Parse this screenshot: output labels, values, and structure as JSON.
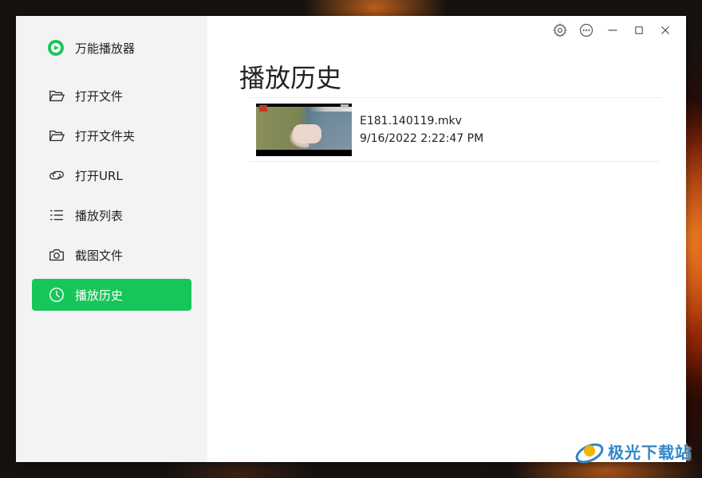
{
  "app": {
    "name": "万能播放器",
    "logo": "play-circle-logo",
    "accent_color": "#16c659"
  },
  "sidebar": {
    "items": [
      {
        "label": "打开文件",
        "icon": "folder-open-icon",
        "active": false
      },
      {
        "label": "打开文件夹",
        "icon": "folder-open-icon",
        "active": false
      },
      {
        "label": "打开URL",
        "icon": "link-icon",
        "active": false
      },
      {
        "label": "播放列表",
        "icon": "list-icon",
        "active": false
      },
      {
        "label": "截图文件",
        "icon": "camera-icon",
        "active": false
      },
      {
        "label": "播放历史",
        "icon": "clock-icon",
        "active": true
      }
    ]
  },
  "title_bar": {
    "buttons": [
      "settings-icon",
      "more-icon",
      "minimize-icon",
      "maximize-icon",
      "close-icon"
    ]
  },
  "main": {
    "title": "播放历史",
    "history": [
      {
        "file_name": "E181.140119.mkv",
        "time": "9/16/2022 2:22:47 PM",
        "thumbnail": "video-thumbnail"
      }
    ]
  },
  "watermark": {
    "text": "极光下载站",
    "color": "#2e86c8"
  }
}
